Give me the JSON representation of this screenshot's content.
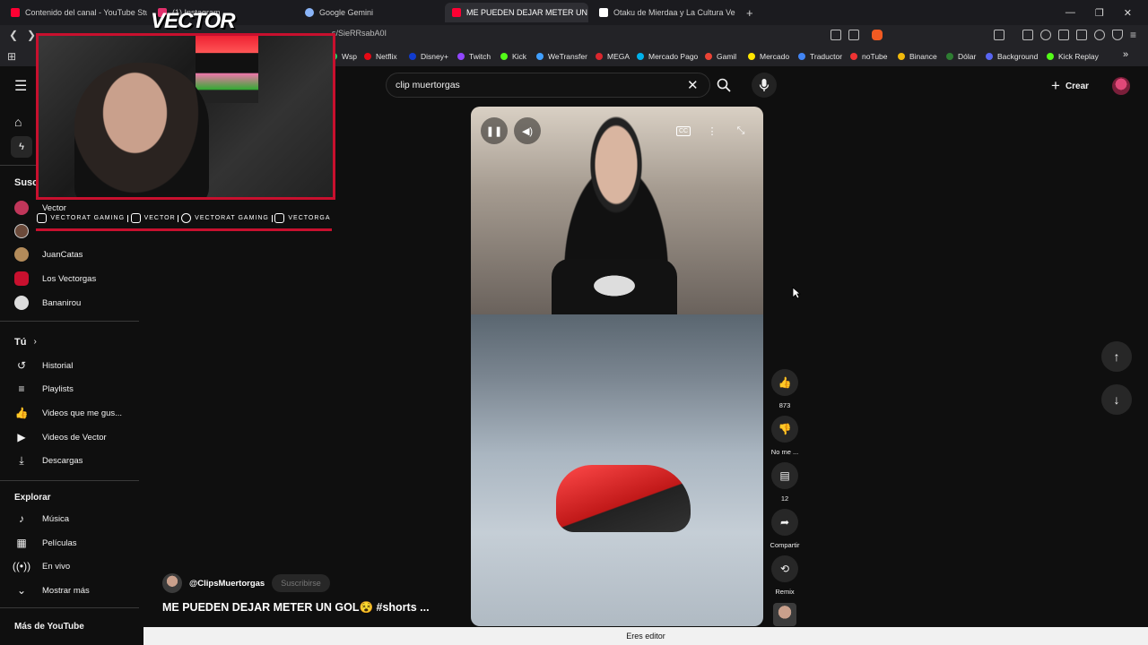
{
  "browser": {
    "tabs": [
      {
        "label": "Contenido del canal - YouTube Studio",
        "color": "#ff0033"
      },
      {
        "label": "(1) Instagram",
        "color": "#e1306c"
      },
      {
        "label": "Google Gemini",
        "color": "#8ab4f8"
      },
      {
        "label": "ME PUEDEN DEJAR METER UN",
        "color": "#ff0033",
        "active": true
      },
      {
        "label": "Otaku de Mierdaa y La Cultura Vector",
        "color": "#ffffff"
      }
    ],
    "new_tab": "+",
    "address": "s/SieRRsabA0I",
    "bookmarks": [
      {
        "label": "Wsp",
        "color": "#25d366"
      },
      {
        "label": "Netflix",
        "color": "#e50914"
      },
      {
        "label": "Disney+",
        "color": "#113ccf"
      },
      {
        "label": "Twitch",
        "color": "#9146ff"
      },
      {
        "label": "Kick",
        "color": "#53fc18"
      },
      {
        "label": "WeTransfer",
        "color": "#409fff"
      },
      {
        "label": "MEGA",
        "color": "#d9272e"
      },
      {
        "label": "Mercado Pago",
        "color": "#00b1ea"
      },
      {
        "label": "Gamil",
        "color": "#ea4335"
      },
      {
        "label": "Mercado",
        "color": "#ffe600"
      },
      {
        "label": "Traductor",
        "color": "#4285f4"
      },
      {
        "label": "noTube",
        "color": "#e33"
      },
      {
        "label": "Binance",
        "color": "#f0b90b"
      },
      {
        "label": "Dólar",
        "color": "#2e7d32"
      },
      {
        "label": "Background",
        "color": "#5865f2"
      },
      {
        "label": "Kick Replay",
        "color": "#53fc18"
      }
    ]
  },
  "overlay": {
    "brand": "VECTOR",
    "socials": [
      {
        "label": "VECTORAT GAMING"
      },
      {
        "label": "VECTOR"
      },
      {
        "label": "VECTORAT GAMING"
      },
      {
        "label": "VECTORGA"
      }
    ]
  },
  "youtube": {
    "search": {
      "value": "clip muertorgas"
    },
    "create_label": "Crear",
    "sidebar": {
      "subs_heading": "Susc",
      "subscriptions": [
        {
          "label": "Vector",
          "color": "#c0365a"
        },
        {
          "label": "",
          "color": "#6b4a3a"
        },
        {
          "label": "JuanCatas",
          "color": "#b38b5a"
        },
        {
          "label": "Los Vectorgas",
          "color": "#c8102e"
        },
        {
          "label": "Bananirou",
          "color": "#dddddd"
        }
      ],
      "you_heading": "Tú",
      "you_items": [
        {
          "label": "Historial",
          "icon": "history-icon"
        },
        {
          "label": "Playlists",
          "icon": "playlist-icon"
        },
        {
          "label": "Videos que me gus...",
          "icon": "thumbs-up-icon"
        },
        {
          "label": "Videos de Vector",
          "icon": "video-icon"
        },
        {
          "label": "Descargas",
          "icon": "download-icon"
        }
      ],
      "explore_heading": "Explorar",
      "explore_items": [
        {
          "label": "Música",
          "icon": "music-icon"
        },
        {
          "label": "Películas",
          "icon": "film-icon"
        },
        {
          "label": "En vivo",
          "icon": "live-icon"
        },
        {
          "label": "Mostrar más",
          "icon": "chevron-down-icon"
        }
      ],
      "more_heading": "Más de YouTube"
    },
    "short": {
      "channel": "@ClipsMuertorgas",
      "subscribe": "Suscribirse",
      "title": "ME PUEDEN DEJAR METER UN GOL😵 #shorts ...",
      "likes": "873",
      "dislike_label": "No me ...",
      "comments": "12",
      "share_label": "Compartir",
      "remix_label": "Remix"
    }
  },
  "status_bar": "Eres editor"
}
